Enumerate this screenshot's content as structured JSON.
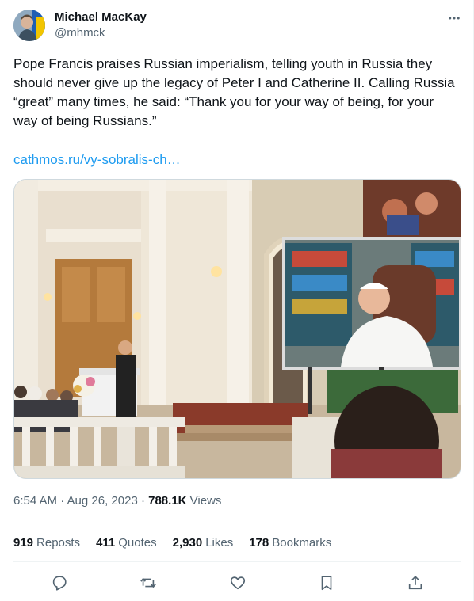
{
  "author": {
    "name": "Michael MacKay",
    "handle": "@mhmck"
  },
  "icons": {
    "more": "more-horizontal-icon",
    "reply": "reply-icon",
    "repost": "repost-icon",
    "like": "like-icon",
    "bookmark": "bookmark-icon",
    "share": "share-icon"
  },
  "tweet": {
    "text_lines": [
      "Pope Francis praises Russian imperialism, telling youth in Russia they",
      "should never give up the legacy of Peter I and Catherine II. Calling Russia",
      "“great” many times, he said: “Thank you for your way of being, for your",
      "way of being Russians.”"
    ],
    "link": "cathmos.ru/vy-sobralis-ch…",
    "time": "6:54 AM · Aug 26, 2023 · ",
    "views_count": "788.1K",
    "views_label": " Views"
  },
  "stats": {
    "reposts_count": "919",
    "reposts_label": "Reposts",
    "quotes_count": "411",
    "quotes_label": "Quotes",
    "likes_count": "2,930",
    "likes_label": "Likes",
    "bookmarks_count": "178",
    "bookmarks_label": "Bookmarks"
  },
  "colors": {
    "link": "#1d9bf0",
    "secondary_text": "#536471",
    "primary_text": "#0f1419",
    "divider": "#eff3f4"
  }
}
